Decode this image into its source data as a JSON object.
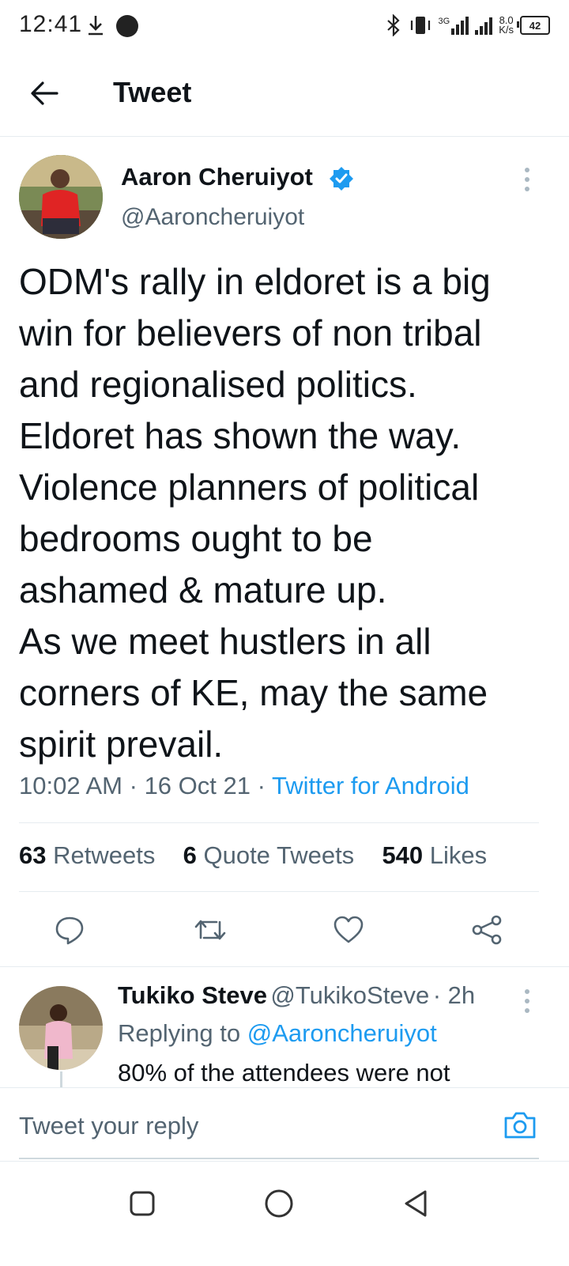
{
  "status_bar": {
    "time": "12:41",
    "download_icon": "download-icon",
    "speed_value": "8.0",
    "speed_unit": "K/s",
    "network_label": "3G",
    "battery": "42"
  },
  "header": {
    "back_icon": "back-arrow-icon",
    "title": "Tweet"
  },
  "tweet": {
    "author_name": "Aaron Cheruiyot",
    "verified_icon": "verified-badge-icon",
    "author_handle": "@Aaroncheruiyot",
    "text": "ODM's rally in eldoret is a big\nwin for believers of non tribal\nand regionalised politics.\nEldoret has shown the way.\nViolence planners of political\nbedrooms ought to be\nashamed & mature up.\nAs we meet hustlers in all\ncorners of KE, may the same\nspirit prevail.",
    "time": "10:02 AM",
    "date": "16 Oct 21",
    "separator": "·",
    "source": "Twitter for Android"
  },
  "stats": {
    "retweets_count": "63",
    "retweets_label": "Retweets",
    "quotes_count": "6",
    "quotes_label": "Quote Tweets",
    "likes_count": "540",
    "likes_label": "Likes"
  },
  "actions": [
    "reply-icon",
    "retweet-icon",
    "like-icon",
    "share-icon"
  ],
  "reply": {
    "name": "Tukiko Steve",
    "handle": "@TukikoSteve",
    "time": "· 2h",
    "replying_label": "Replying to",
    "replying_to": "@Aaroncheruiyot",
    "text": "80% of the attendees were not"
  },
  "composer": {
    "placeholder": "Tweet your reply",
    "camera_icon": "camera-icon"
  },
  "nav_bar": [
    "recents-icon",
    "home-icon",
    "back-icon"
  ],
  "colors": {
    "accent": "#1d9bf0",
    "secondary_text": "#536471",
    "divider": "#e6ecf0"
  }
}
